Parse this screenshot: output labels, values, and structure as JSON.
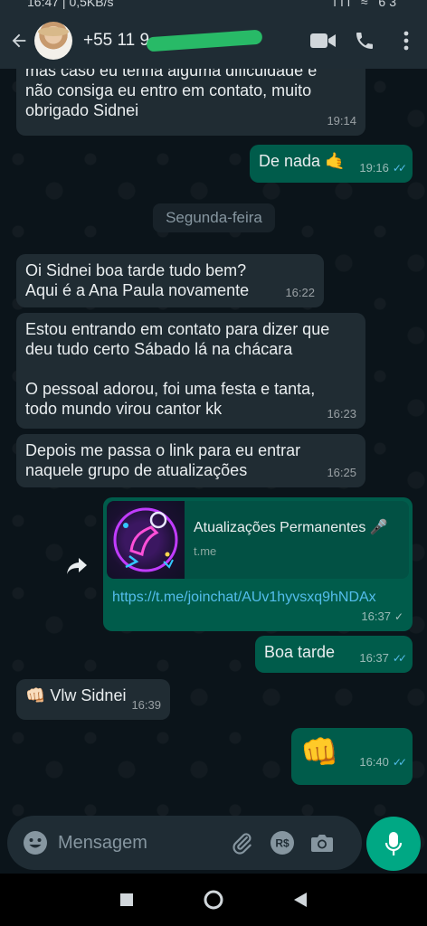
{
  "status_bar": {
    "text": "16:47 | 0,5KB/s",
    "right_text": "ııl ≈ 63"
  },
  "header": {
    "contact_name": "+55 11 9",
    "back_icon": "back-arrow-icon",
    "video_icon": "video-call-icon",
    "call_icon": "phone-icon",
    "menu_icon": "more-vert-icon"
  },
  "messages": [
    {
      "text": "mas caso eu tenha alguma dificuldade e\nnão consiga eu entro em contato, muito\nobrigado Sidnei",
      "time": "19:14"
    },
    {
      "text": "De nada 🤙",
      "time": "19:16"
    },
    {
      "text": "Oi Sidnei boa tarde tudo bem?\nAqui é a Ana Paula novamente",
      "time": "16:22"
    },
    {
      "text": "Estou entrando em contato para dizer que\ndeu tudo certo Sábado lá na chácara\n\nO pessoal adorou, foi uma festa e tanta,\ntodo mundo virou cantor kk",
      "time": "16:23"
    },
    {
      "text": "Depois me passa o link para eu entrar\nnaquele grupo de atualizações",
      "time": "16:25"
    },
    {
      "text": "Boa tarde",
      "time": "16:37"
    },
    {
      "text": "👊🏻 Vlw Sidnei",
      "time": "16:39"
    },
    {
      "text": "👊",
      "time": "16:40"
    }
  ],
  "date_separator": "Segunda-feira",
  "link_message": {
    "title": "Atualizações Permanentes 🎤",
    "domain": "t.me",
    "url": "https://t.me/joinchat/AUv1hyvsxq9hNDAx",
    "time": "16:37"
  },
  "input": {
    "placeholder": "Mensagem"
  },
  "colors": {
    "header_bg": "#1f2c34",
    "chat_bg": "#0b141a",
    "incoming": "#202c33",
    "outgoing": "#005c4b",
    "accent": "#00a884",
    "tick_read": "#53bdeb"
  }
}
